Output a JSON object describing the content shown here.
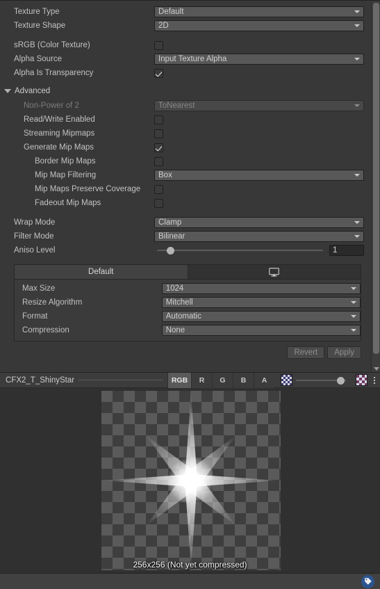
{
  "inspector": {
    "basic_rows": [
      {
        "label": "Texture Type",
        "control": "dropdown",
        "value": "Default"
      },
      {
        "label": "Texture Shape",
        "control": "dropdown",
        "value": "2D"
      },
      {
        "label": "sRGB (Color Texture)",
        "control": "checkbox",
        "value": "off"
      },
      {
        "label": "Alpha Source",
        "control": "dropdown",
        "value": "Input Texture Alpha"
      },
      {
        "label": "Alpha Is Transparency",
        "control": "checkbox",
        "value": "on"
      }
    ],
    "advanced": {
      "title": "Advanced",
      "expanded": true,
      "rows": [
        {
          "label": "Non-Power of 2",
          "control": "dropdown",
          "value": "ToNearest",
          "disabled": true
        },
        {
          "label": "Read/Write Enabled",
          "control": "checkbox",
          "value": "off"
        },
        {
          "label": "Streaming Mipmaps",
          "control": "checkbox",
          "value": "off"
        },
        {
          "label": "Generate Mip Maps",
          "control": "checkbox",
          "value": "on"
        },
        {
          "label": "Border Mip Maps",
          "control": "checkbox",
          "value": "off"
        },
        {
          "label": "Mip Map Filtering",
          "control": "dropdown",
          "value": "Box"
        },
        {
          "label": "Mip Maps Preserve Coverage",
          "control": "checkbox",
          "value": "off"
        },
        {
          "label": "Fadeout Mip Maps",
          "control": "checkbox",
          "value": "off"
        }
      ]
    },
    "filter_rows": [
      {
        "label": "Wrap Mode",
        "control": "dropdown",
        "value": "Clamp"
      },
      {
        "label": "Filter Mode",
        "control": "dropdown",
        "value": "Bilinear"
      }
    ],
    "aniso": {
      "label": "Aniso Level",
      "value": "1",
      "min": 0,
      "max": 16,
      "knob_percent": 6
    },
    "platform": {
      "tabs": [
        {
          "label": "Default",
          "icon": "",
          "active": true
        },
        {
          "label": "",
          "icon": "monitor-icon",
          "active": false
        }
      ],
      "rows": [
        {
          "label": "Max Size",
          "value": "1024"
        },
        {
          "label": "Resize Algorithm",
          "value": "Mitchell"
        },
        {
          "label": "Format",
          "value": "Automatic"
        },
        {
          "label": "Compression",
          "value": "None"
        }
      ]
    },
    "buttons": {
      "revert": "Revert",
      "apply": "Apply"
    }
  },
  "preview": {
    "title": "CFX2_T_ShinyStar",
    "channels": [
      {
        "label": "RGB",
        "active": true
      },
      {
        "label": "R",
        "active": false
      },
      {
        "label": "G",
        "active": false
      },
      {
        "label": "B",
        "active": false
      },
      {
        "label": "A",
        "active": false
      }
    ],
    "mip_slider": {
      "min_icon": "checker-small-icon",
      "max_icon": "checker-large-icon",
      "knob_percent": 100
    },
    "menu_icon": "kebab-menu-icon",
    "info_text": "256x256 (Not yet compressed)"
  },
  "status_bar": {
    "badge_icon": "tag-icon"
  },
  "colors": {
    "window_bg": "#383838",
    "preview_bg": "#303030",
    "dropdown_bg": "#585858",
    "accent_blue": "#2b5490",
    "text": "#c2c2c2",
    "text_dim": "#7c7c7c"
  }
}
